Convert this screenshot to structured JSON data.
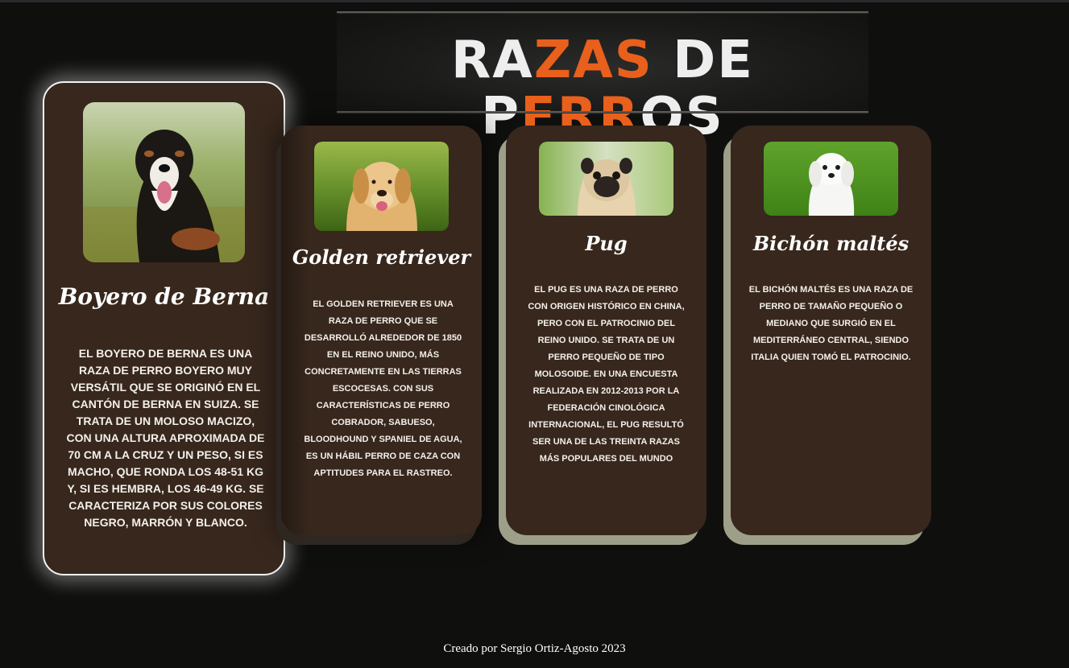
{
  "header": {
    "title_parts": [
      {
        "t": "RA",
        "c": "w"
      },
      {
        "t": "ZAS",
        "c": "o"
      },
      {
        "t": " DE ",
        "c": "w"
      },
      {
        "t": "P",
        "c": "w"
      },
      {
        "t": "ERR",
        "c": "o"
      },
      {
        "t": "OS",
        "c": "w"
      }
    ]
  },
  "colors": {
    "accent": "#e8601c",
    "card_bg": "#37271d",
    "card_shadow": "#9e9f88",
    "page_bg": "#0f0f0e"
  },
  "cards": [
    {
      "name": "Boyero de Berna",
      "image_icon": "bernese-mountain-dog-photo",
      "description": "El boyero de Berna es una raza de perro boyero muy versátil que se originó en el cantón de Berna en Suiza. Se trata de un moloso macizo, con una altura aproximada de 70 cm a la cruz y un peso, si es macho, que ronda los 48-51 kg y, si es hembra, los 46-49 kg. Se caracteriza por sus colores negro, marrón y blanco."
    },
    {
      "name": "Golden retriever",
      "image_icon": "golden-retriever-photo",
      "description": "El golden retriever es una raza de perro que se desarrolló alrededor de 1850 en el Reino Unido, más concretamente en las tierras escocesas. Con sus características de perro cobrador, sabueso, bloodhound y spaniel de agua, es un hábil perro de caza con aptitudes para el rastreo."
    },
    {
      "name": "Pug",
      "image_icon": "pug-photo",
      "description": "El pug es una raza de perro con origen histórico en China, pero con el patrocinio del Reino Unido. Se trata de un perro pequeño de tipo molosoide. En una encuesta realizada en 2012-2013 por la Federación Cinológica Internacional, el pug resultó ser una de las treinta razas más populares del mundo"
    },
    {
      "name": "Bichón maltés",
      "image_icon": "maltese-dog-photo",
      "description": "El bichón maltés es una raza de perro de tamaño pequeño o mediano que surgió en el Mediterráneo central, siendo Italia quien tomó el patrocinio."
    }
  ],
  "footer": {
    "text": "Creado por Sergio Ortiz-Agosto 2023"
  }
}
